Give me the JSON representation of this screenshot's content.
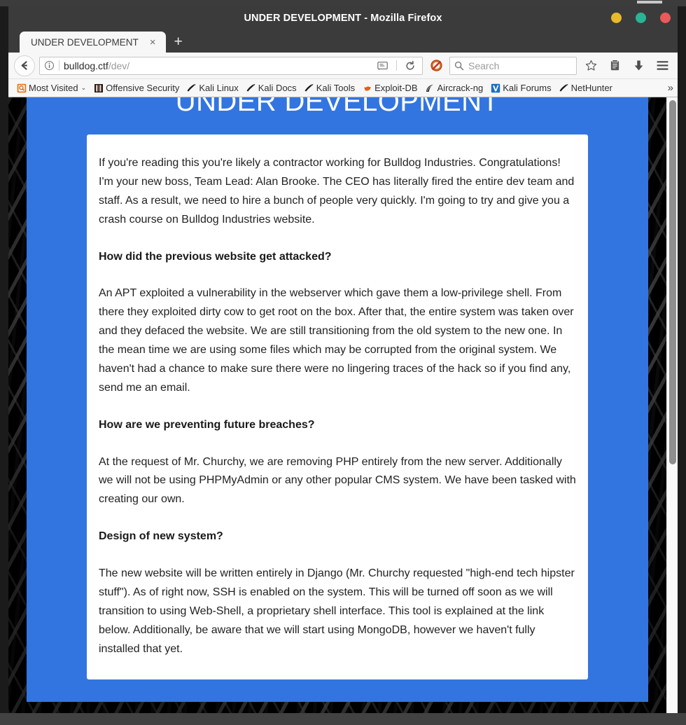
{
  "window": {
    "title": "UNDER DEVELOPMENT - Mozilla Firefox",
    "buttons": {
      "minimize": "minimize",
      "maximize": "maximize",
      "close": "close"
    },
    "colors": {
      "minimize": "#e8b92b",
      "maximize": "#2bb396",
      "close": "#ea5a5a",
      "titlebar": "#3b3b3b"
    }
  },
  "tabs": {
    "active": {
      "label": "UNDER DEVELOPMENT",
      "close_label": "×"
    },
    "new_tab_label": "+"
  },
  "toolbar": {
    "back_icon": "back-arrow-icon",
    "identity_icon": "info-circle-icon",
    "url": {
      "host": "bulldog.ctf",
      "path": "/dev/",
      "full": "bulldog.ctf/dev/"
    },
    "reader_icon": "reader-mode-icon",
    "reload_icon": "reload-icon",
    "noscript_icon": "noscript-icon",
    "search": {
      "placeholder": "Search",
      "icon": "search-icon"
    },
    "bookmark_star_icon": "star-icon",
    "library_icon": "library-icon",
    "downloads_icon": "download-arrow-icon",
    "menu_icon": "hamburger-menu-icon"
  },
  "bookmarks": {
    "items": [
      {
        "label": "Most Visited",
        "icon": "most-visited-icon",
        "has_chevron": true
      },
      {
        "label": "Offensive Security",
        "icon": "offensive-security-icon",
        "has_chevron": false
      },
      {
        "label": "Kali Linux",
        "icon": "kali-dragon-icon",
        "has_chevron": false
      },
      {
        "label": "Kali Docs",
        "icon": "kali-dragon-icon",
        "has_chevron": false
      },
      {
        "label": "Kali Tools",
        "icon": "kali-dragon-icon",
        "has_chevron": false
      },
      {
        "label": "Exploit-DB",
        "icon": "exploit-db-icon",
        "has_chevron": false
      },
      {
        "label": "Aircrack-ng",
        "icon": "aircrack-ng-icon",
        "has_chevron": false
      },
      {
        "label": "Kali Forums",
        "icon": "kali-forums-icon",
        "has_chevron": false
      },
      {
        "label": "NetHunter",
        "icon": "kali-dragon-icon",
        "has_chevron": false
      }
    ],
    "overflow_label": "»",
    "chevron": "⌄"
  },
  "page": {
    "title": "UNDER DEVELOPMENT",
    "accent_color": "#3375e0",
    "paragraphs": [
      {
        "kind": "body",
        "text": "If you're reading this you're likely a contractor working for Bulldog Industries. Congratulations! I'm your new boss, Team Lead: Alan Brooke. The CEO has literally fired the entire dev team and staff. As a result, we need to hire a bunch of people very quickly. I'm going to try and give you a crash course on Bulldog Industries website."
      },
      {
        "kind": "heading",
        "text": "How did the previous website get attacked?"
      },
      {
        "kind": "body",
        "text": "An APT exploited a vulnerability in the webserver which gave them a low-privilege shell. From there they exploited dirty cow to get root on the box. After that, the entire system was taken over and they defaced the website. We are still transitioning from the old system to the new one. In the mean time we are using some files which may be corrupted from the original system. We haven't had a chance to make sure there were no lingering traces of the hack so if you find any, send me an email."
      },
      {
        "kind": "heading",
        "text": "How are we preventing future breaches?"
      },
      {
        "kind": "body",
        "text": "At the request of Mr. Churchy, we are removing PHP entirely from the new server. Additionally we will not be using PHPMyAdmin or any other popular CMS system. We have been tasked with creating our own."
      },
      {
        "kind": "heading",
        "text": "Design of new system?"
      },
      {
        "kind": "body",
        "text": "The new website will be written entirely in Django (Mr. Churchy requested \"high-end tech hipster stuff\"). As of right now, SSH is enabled on the system. This will be turned off soon as we will transition to using Web-Shell, a proprietary shell interface. This tool is explained at the link below. Additionally, be aware that we will start using MongoDB, however we haven't fully installed that yet."
      }
    ]
  }
}
